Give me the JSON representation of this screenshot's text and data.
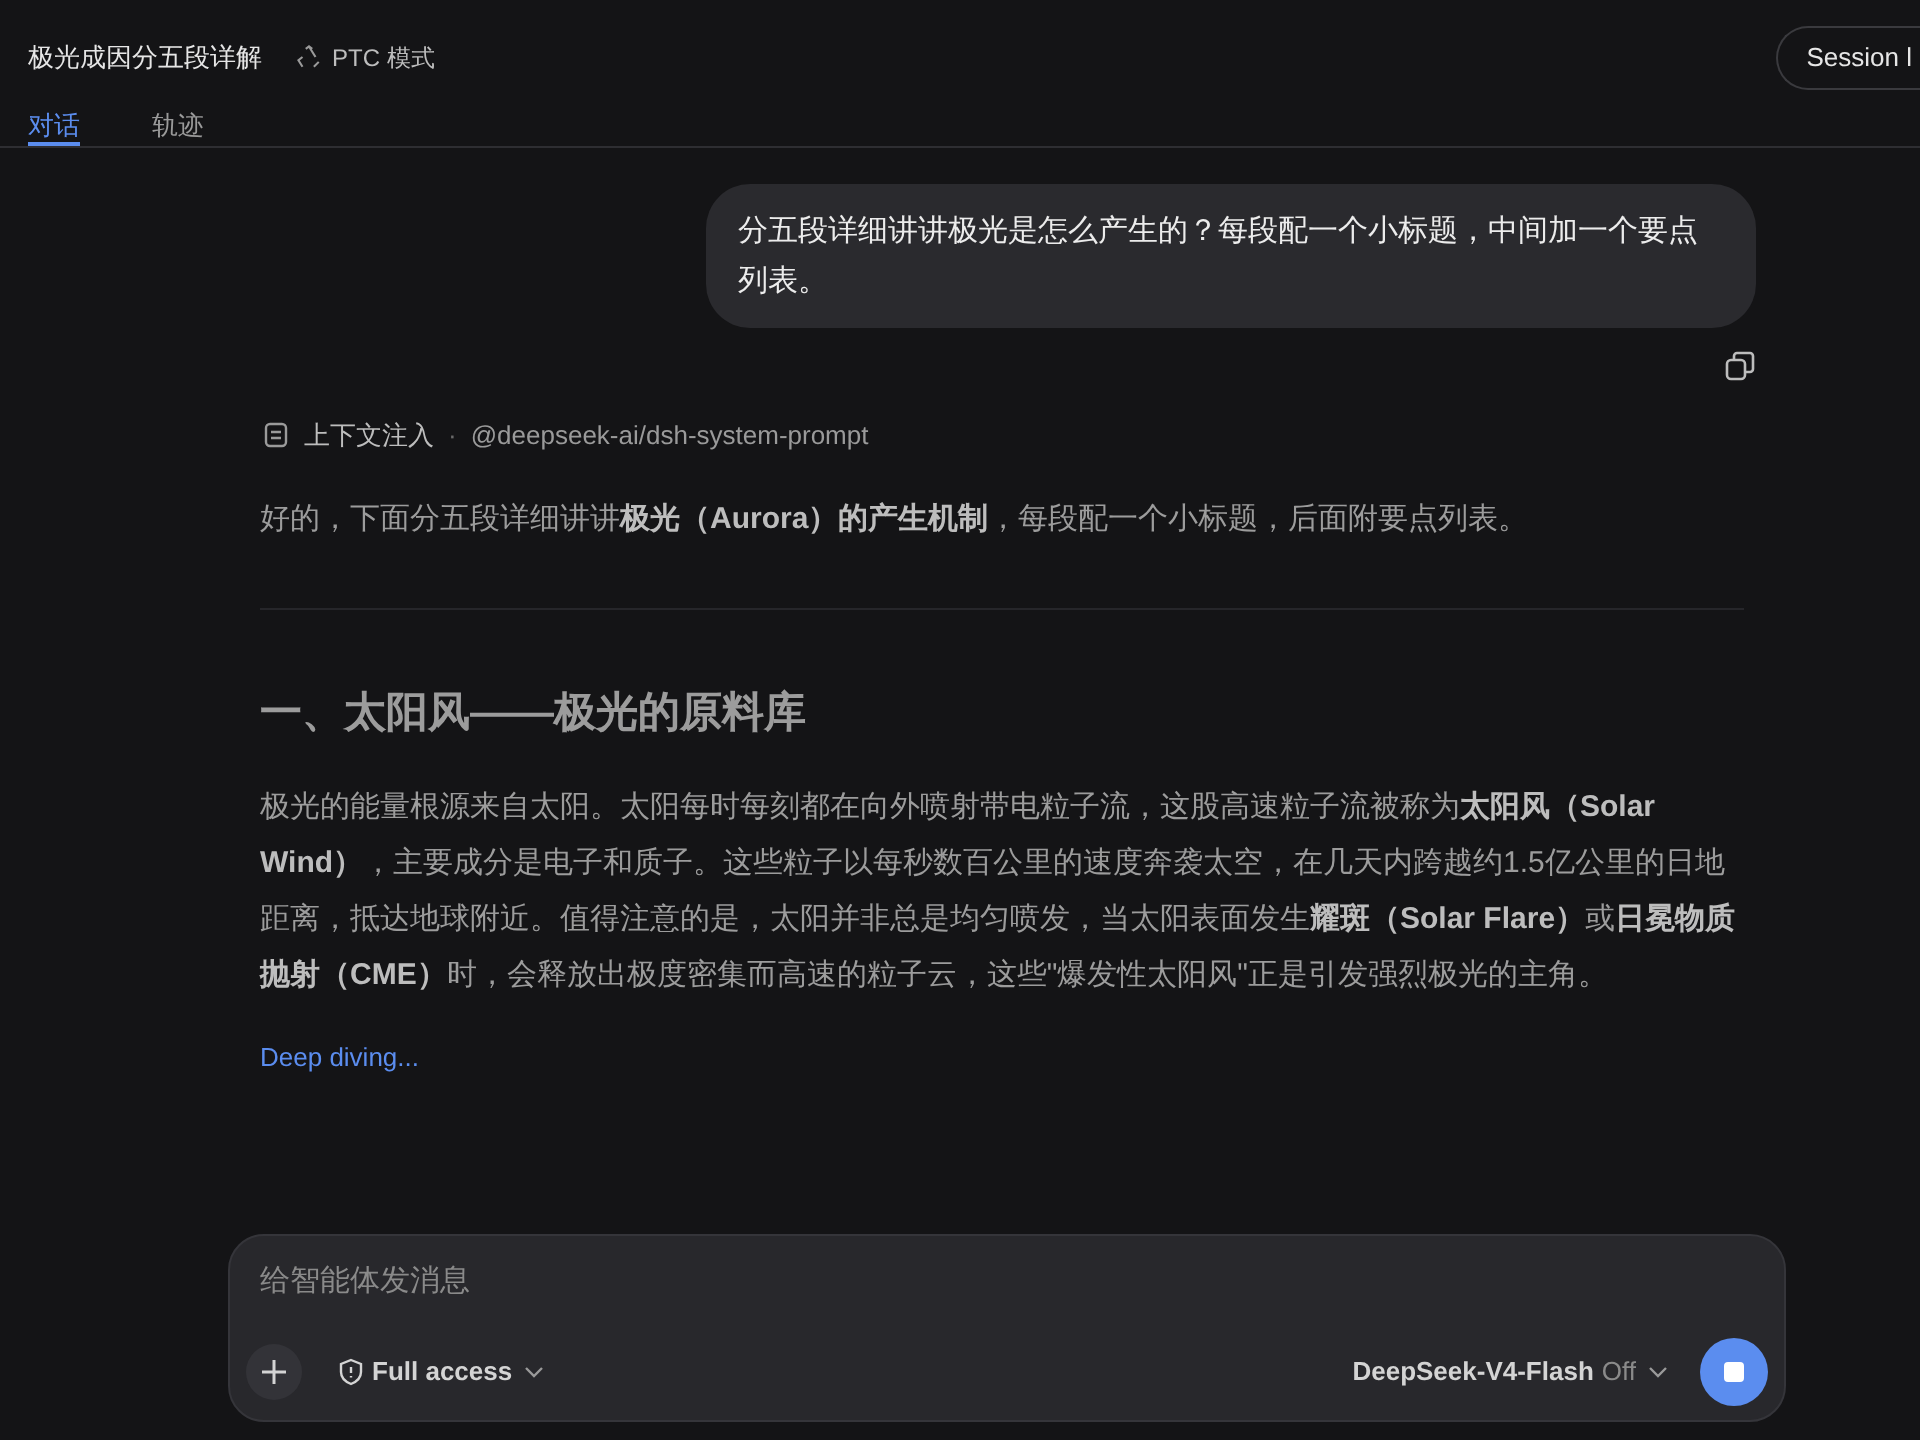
{
  "header": {
    "title": "极光成因分五段详解",
    "mode_badge": "PTC 模式",
    "session_button": "Session l"
  },
  "tabs": [
    {
      "label": "对话",
      "selected": true
    },
    {
      "label": "轨迹",
      "selected": false
    }
  ],
  "user_message": "分五段详细讲讲极光是怎么产生的？每段配一个小标题，中间加一个要点列表。",
  "context": {
    "label": "上下文注入",
    "separator": "·",
    "source": "@deepseek-ai/dsh-system-prompt"
  },
  "intro": "好的，下面分五段详细讲讲**极光（Aurora）的产生机制**，每段配一个小标题，后面附要点列表。",
  "section_heading": "一、太阳风——极光的原料库",
  "section_body": "极光的能量根源来自太阳。太阳每时每刻都在向外喷射带电粒子流，这股高速粒子流被称为**太阳风（Solar Wind）**，主要成分是电子和质子。这些粒子以每秒数百公里的速度奔袭太空，在几天内跨越约1.5亿公里的日地距离，抵达地球附近。值得注意的是，太阳并非总是均匀喷发，当太阳表面发生**耀斑（Solar Flare）**或**日冕物质抛射（CME）**时，会释放出极度密集而高速的粒子云，这些\"爆发性太阳风\"正是引发强烈极光的主角。",
  "status": "Deep diving...",
  "composer": {
    "placeholder": "给智能体发消息",
    "access": "Full access",
    "model": "DeepSeek-V4-Flash",
    "thinking": "Off"
  }
}
